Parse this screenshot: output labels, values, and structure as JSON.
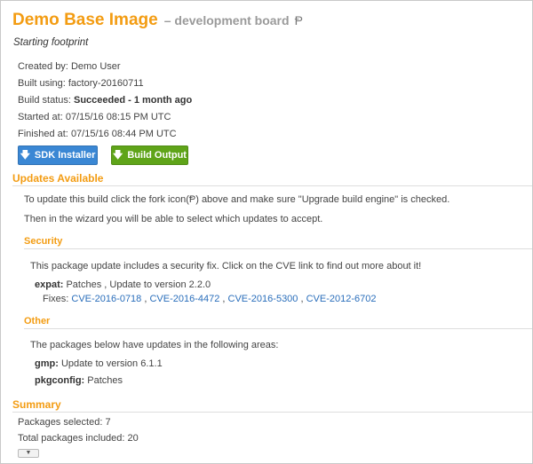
{
  "header": {
    "title": "Demo Base Image",
    "subtitle": "– development board",
    "fork_icon_glyph": "Ᵽ",
    "description": "Starting footprint"
  },
  "meta": {
    "created_label": "Created by:",
    "created_value": "Demo User",
    "built_label": "Built using:",
    "built_value": "factory-20160711",
    "status_label": "Build status:",
    "status_value": "Succeeded - 1 month ago",
    "started_label": "Started at:",
    "started_value": "07/15/16 08:15 PM UTC",
    "finished_label": "Finished at:",
    "finished_value": "07/15/16 08:44 PM UTC"
  },
  "buttons": {
    "sdk_label": "SDK Installer",
    "output_label": "Build Output"
  },
  "updates": {
    "heading": "Updates Available",
    "instruction_before": "To update this build click the fork icon(",
    "instruction_after": ") above and make sure \"Upgrade build engine\" is checked.",
    "wizard_text": "Then in the wizard you will be able to select which updates to accept."
  },
  "security": {
    "heading": "Security",
    "intro": "This package update includes a security fix. Click on the CVE link to find out more about it!",
    "package_name": "expat:",
    "package_detail": "Patches , Update to version 2.2.0",
    "fixes_label": "Fixes:",
    "cves": [
      "CVE-2016-0718",
      "CVE-2016-4472",
      "CVE-2016-5300",
      "CVE-2012-6702"
    ],
    "separator": " , "
  },
  "other": {
    "heading": "Other",
    "intro": "The packages below have updates in the following areas:",
    "packages": [
      {
        "name": "gmp:",
        "detail": "Update to version 6.1.1"
      },
      {
        "name": "pkgconfig:",
        "detail": "Patches"
      }
    ]
  },
  "summary": {
    "heading": "Summary",
    "selected_label": "Packages selected:",
    "selected_value": "7",
    "total_label": "Total packages included:",
    "total_value": "20"
  },
  "colors": {
    "accent": "#f39c12",
    "sdk_button": "#3a87d4",
    "output_button": "#5fa419",
    "link": "#2a6ebb"
  }
}
